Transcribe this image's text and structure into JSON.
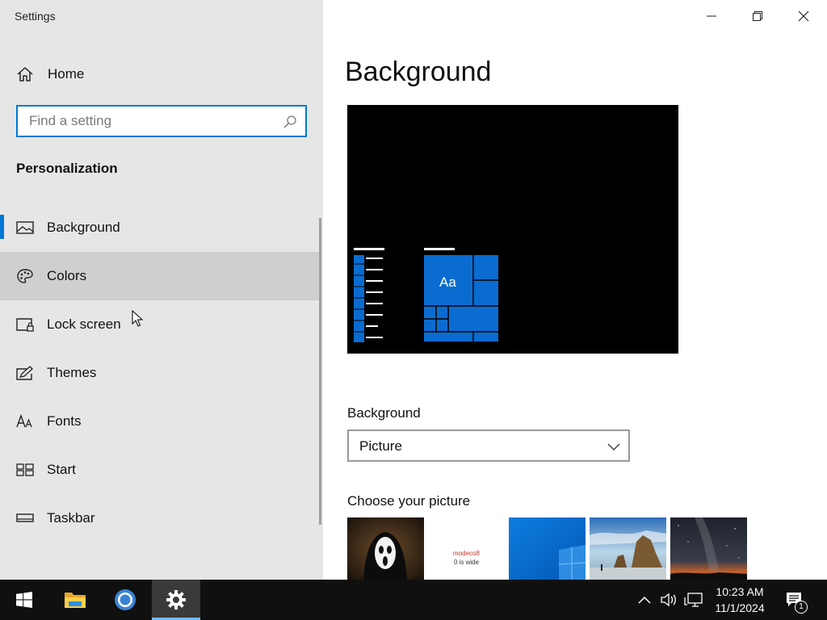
{
  "window": {
    "title": "Settings",
    "controls": [
      "minimize-icon",
      "restore-icon",
      "close-icon"
    ]
  },
  "sidebar": {
    "home_label": "Home",
    "search": {
      "placeholder": "Find a setting",
      "value": ""
    },
    "section_title": "Personalization",
    "items": [
      {
        "label": "Background",
        "icon": "picture-icon",
        "selected": true
      },
      {
        "label": "Colors",
        "icon": "palette-icon",
        "hovered": true
      },
      {
        "label": "Lock screen",
        "icon": "lock-screen-icon"
      },
      {
        "label": "Themes",
        "icon": "themes-icon"
      },
      {
        "label": "Fonts",
        "icon": "fonts-icon"
      },
      {
        "label": "Start",
        "icon": "start-icon"
      },
      {
        "label": "Taskbar",
        "icon": "taskbar-icon"
      }
    ]
  },
  "main": {
    "title": "Background",
    "preview": {
      "tile_text": "Aa"
    },
    "background_label": "Background",
    "background_select": {
      "value": "Picture"
    },
    "choose_label": "Choose your picture",
    "thumbnails": [
      {
        "name": "ghostface"
      },
      {
        "name": "text-image",
        "lines": [
          "modeco8",
          "0 is wide"
        ]
      },
      {
        "name": "windows-blue"
      },
      {
        "name": "beach-rocks"
      },
      {
        "name": "night-sky"
      }
    ]
  },
  "taskbar": {
    "apps": [
      "start-button",
      "file-explorer",
      "chrome",
      "settings"
    ],
    "clock_time": "10:23 AM",
    "clock_date": "11/1/2024",
    "notification_count": "1"
  },
  "colors": {
    "accent": "#0078d7",
    "sidebar_bg": "#e6e6e6",
    "hover_bg": "#cfcfcf",
    "taskbar_bg": "#101010"
  }
}
